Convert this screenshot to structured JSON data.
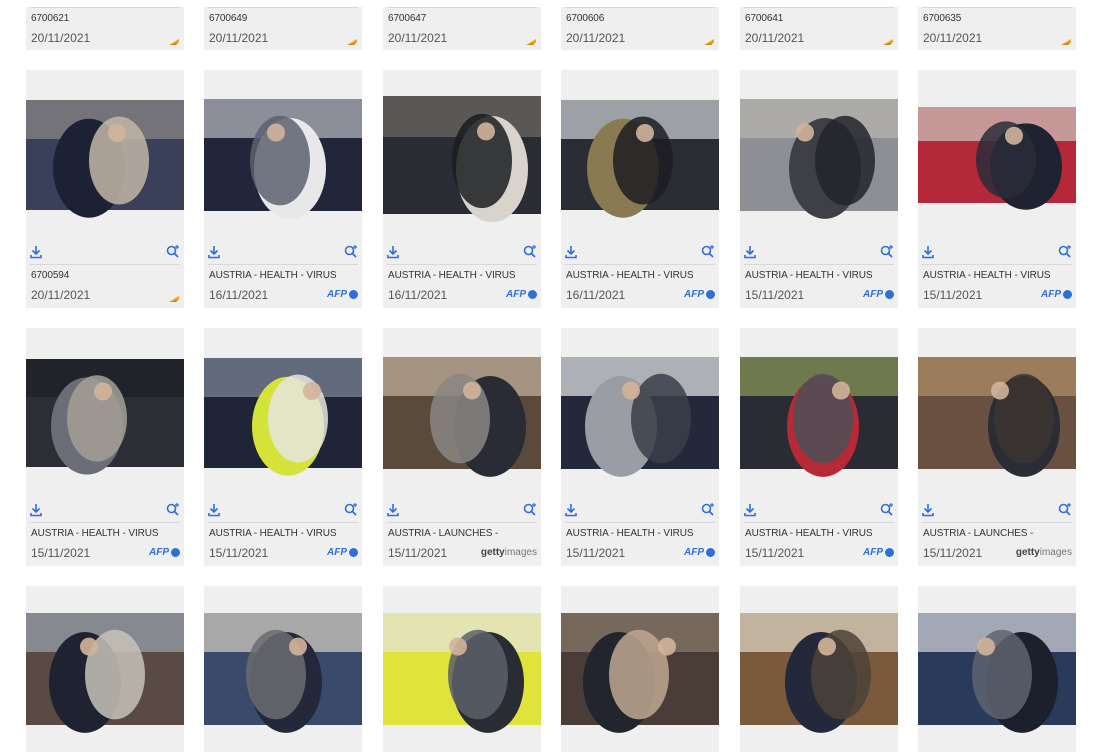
{
  "colors": {
    "card_bg": "#efefef",
    "accent": "#2f6fd8",
    "flag": "#f2a20c"
  },
  "icons": {
    "download": "download-icon",
    "zoom": "zoom-in-icon",
    "flag": "flag-icon"
  },
  "top_row": [
    {
      "id": "6700621",
      "date": "20/11/2021"
    },
    {
      "id": "6700649",
      "date": "20/11/2021"
    },
    {
      "id": "6700647",
      "date": "20/11/2021"
    },
    {
      "id": "6700606",
      "date": "20/11/2021"
    },
    {
      "id": "6700641",
      "date": "20/11/2021"
    },
    {
      "id": "6700635",
      "date": "20/11/2021"
    }
  ],
  "rows": [
    [
      {
        "title": "6700594",
        "date": "20/11/2021",
        "source": "flag"
      },
      {
        "title": "AUSTRIA - HEALTH - VIRUS",
        "date": "16/11/2021",
        "source": "afp"
      },
      {
        "title": "AUSTRIA - HEALTH - VIRUS",
        "date": "16/11/2021",
        "source": "afp"
      },
      {
        "title": "AUSTRIA - HEALTH - VIRUS",
        "date": "16/11/2021",
        "source": "afp"
      },
      {
        "title": "AUSTRIA - HEALTH - VIRUS",
        "date": "15/11/2021",
        "source": "afp"
      },
      {
        "title": "AUSTRIA - HEALTH - VIRUS",
        "date": "15/11/2021",
        "source": "afp"
      }
    ],
    [
      {
        "title": "AUSTRIA - HEALTH - VIRUS",
        "date": "15/11/2021",
        "source": "afp"
      },
      {
        "title": "AUSTRIA - HEALTH - VIRUS",
        "date": "15/11/2021",
        "source": "afp"
      },
      {
        "title": "AUSTRIA - LAUNCHES -",
        "date": "15/11/2021",
        "source": "getty"
      },
      {
        "title": "AUSTRIA - HEALTH - VIRUS",
        "date": "15/11/2021",
        "source": "afp"
      },
      {
        "title": "AUSTRIA - HEALTH - VIRUS",
        "date": "15/11/2021",
        "source": "afp"
      },
      {
        "title": "AUSTRIA - LAUNCHES -",
        "date": "15/11/2021",
        "source": "getty"
      }
    ]
  ],
  "agency": {
    "afp": "AFP",
    "getty_bold": "getty",
    "getty_rest": "images"
  }
}
